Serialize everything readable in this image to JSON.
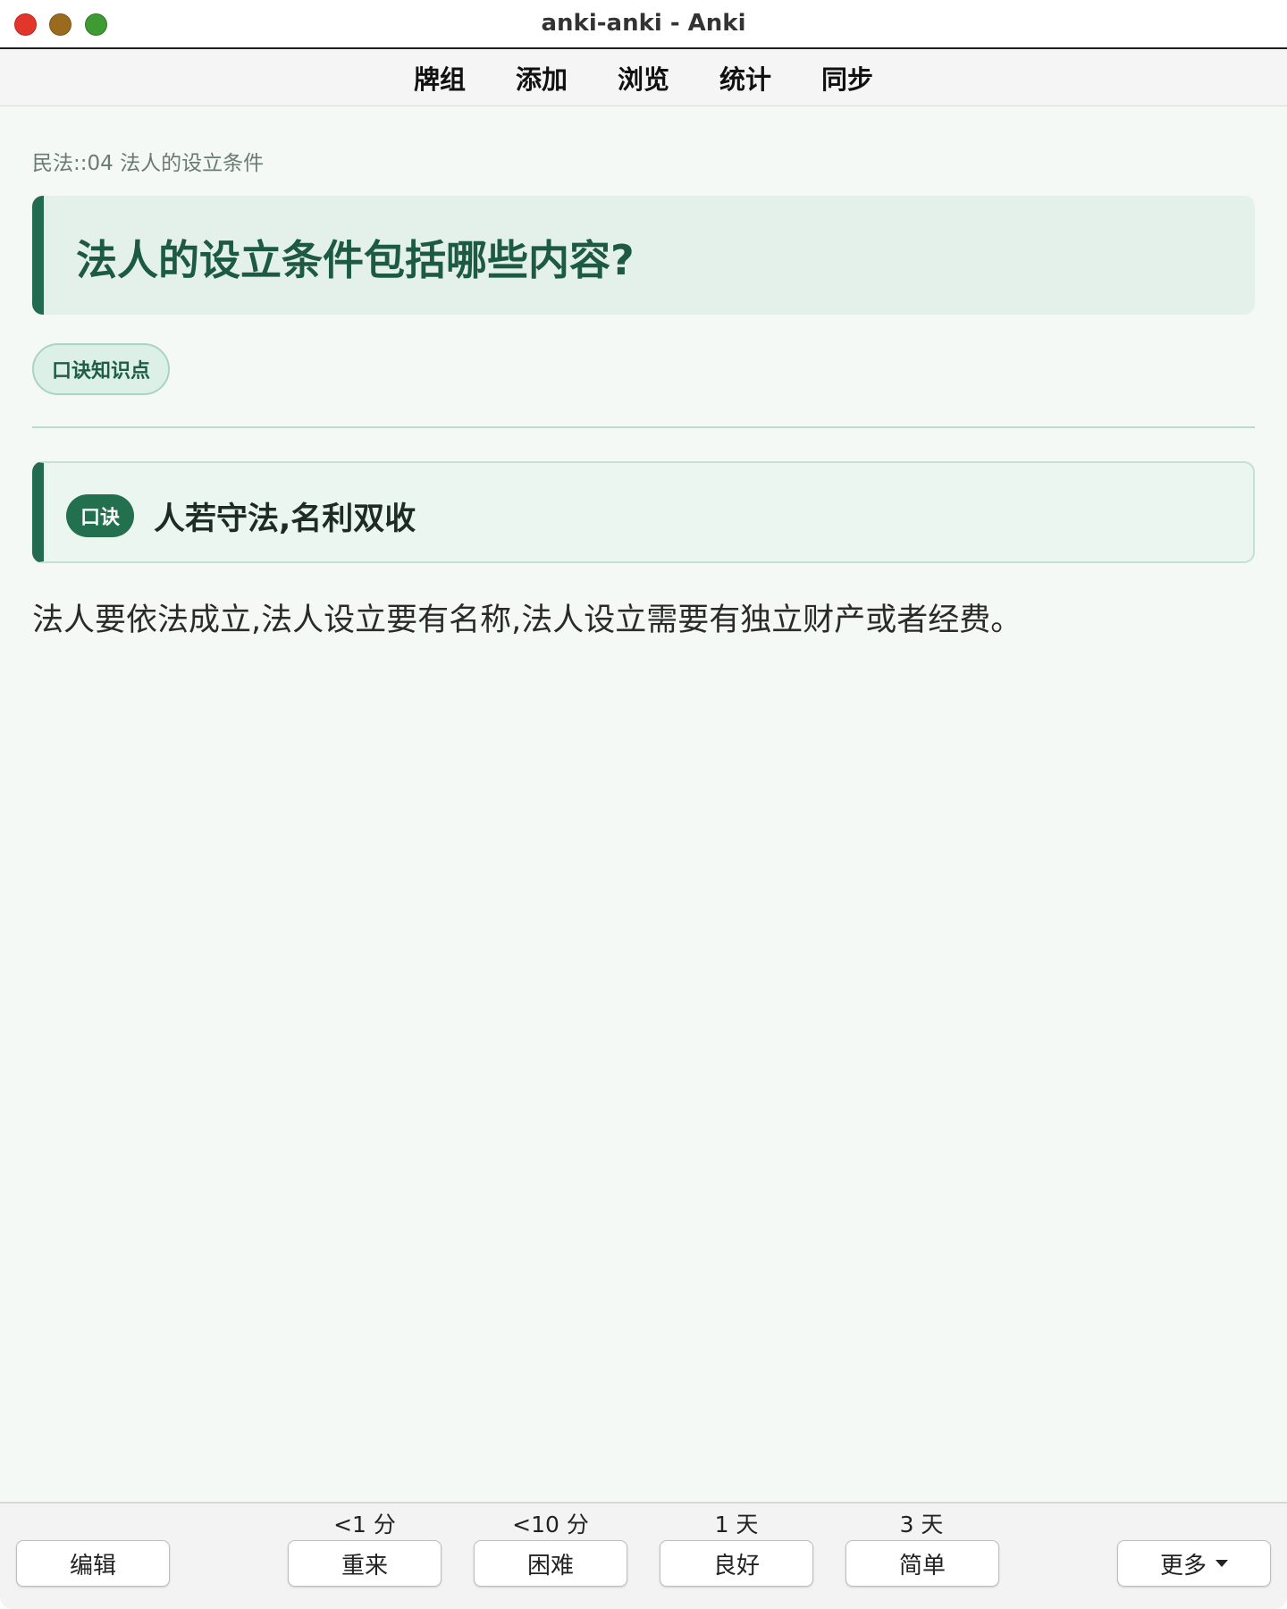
{
  "window": {
    "title": "anki-anki - Anki"
  },
  "toolbar": {
    "items": [
      "牌组",
      "添加",
      "浏览",
      "统计",
      "同步"
    ]
  },
  "card": {
    "deck_path": "民法::04 法人的设立条件",
    "question": "法人的设立条件包括哪些内容?",
    "tag": "口诀知识点",
    "mnemonic_badge": "口诀",
    "mnemonic_text": "人若守法,名利双收",
    "explanation": "法人要依法成立,法人设立要有名称,法人设立需要有独立财产或者经费。"
  },
  "bottombar": {
    "edit_label": "编辑",
    "more_label": "更多",
    "answers": [
      {
        "interval": "<1 分",
        "label": "重来"
      },
      {
        "interval": "<10 分",
        "label": "困难"
      },
      {
        "interval": "1 天",
        "label": "良好"
      },
      {
        "interval": "3 天",
        "label": "简单"
      }
    ]
  }
}
